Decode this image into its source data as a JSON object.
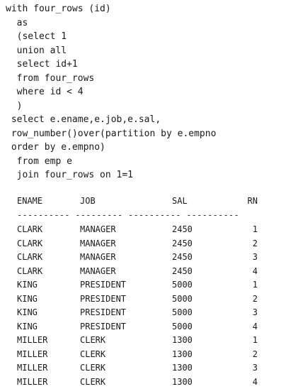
{
  "code_lines": [
    "with four_rows (id)",
    "  as",
    "  (select 1",
    "  union all",
    "  select id+1",
    "  from four_rows",
    "  where id < 4",
    "  )",
    " select e.ename,e.job,e.sal,",
    " row_number()over(partition by e.empno",
    " order by e.empno)",
    "  from emp e",
    "  join four_rows on 1=1"
  ],
  "result": {
    "columns": [
      "ENAME",
      "JOB",
      "SAL",
      "RN"
    ],
    "separator": "---------- --------- ---------- ----------",
    "rows": [
      [
        "CLARK",
        "MANAGER",
        "2450",
        "1"
      ],
      [
        "CLARK",
        "MANAGER",
        "2450",
        "2"
      ],
      [
        "CLARK",
        "MANAGER",
        "2450",
        "3"
      ],
      [
        "CLARK",
        "MANAGER",
        "2450",
        "4"
      ],
      [
        "KING",
        "PRESIDENT",
        "5000",
        "1"
      ],
      [
        "KING",
        "PRESIDENT",
        "5000",
        "2"
      ],
      [
        "KING",
        "PRESIDENT",
        "5000",
        "3"
      ],
      [
        "KING",
        "PRESIDENT",
        "5000",
        "4"
      ],
      [
        "MILLER",
        "CLERK",
        "1300",
        "1"
      ],
      [
        "MILLER",
        "CLERK",
        "1300",
        "2"
      ],
      [
        "MILLER",
        "CLERK",
        "1300",
        "3"
      ],
      [
        "MILLER",
        "CLERK",
        "1300",
        "4"
      ]
    ]
  }
}
